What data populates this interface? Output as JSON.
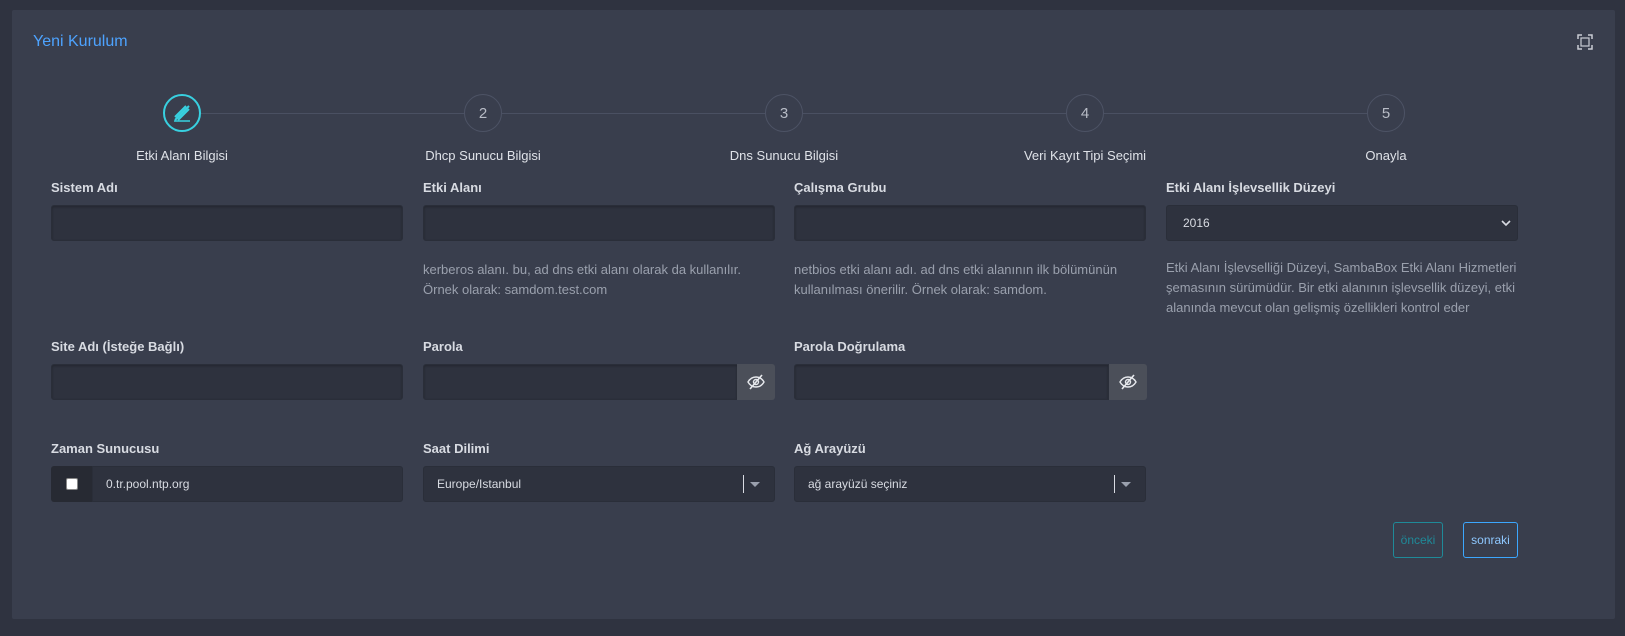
{
  "card": {
    "title": "Yeni Kurulum",
    "fullscreen_icon": "fullscreen-icon"
  },
  "steps": [
    {
      "number": "",
      "label": "Etki Alanı Bilgisi",
      "icon": "edit-icon",
      "active": true
    },
    {
      "number": "2",
      "label": "Dhcp Sunucu Bilgisi"
    },
    {
      "number": "3",
      "label": "Dns Sunucu Bilgisi"
    },
    {
      "number": "4",
      "label": "Veri Kayıt Tipi Seçimi"
    },
    {
      "number": "5",
      "label": "Onayla"
    }
  ],
  "form": {
    "system_name": {
      "label": "Sistem Adı",
      "value": ""
    },
    "domain": {
      "label": "Etki Alanı",
      "value": "",
      "help": "kerberos alanı. bu, ad dns etki alanı olarak da kullanılır. Örnek olarak: samdom.test.com"
    },
    "workgroup": {
      "label": "Çalışma Grubu",
      "value": "",
      "help": "netbios etki alanı adı. ad dns etki alanının ilk bölümünün kullanılması önerilir. Örnek olarak: samdom."
    },
    "functional_level": {
      "label": "Etki Alanı İşlevsellik Düzeyi",
      "value": "2016",
      "help": "Etki Alanı İşlevselliği Düzeyi, SambaBox Etki Alanı Hizmetleri şemasının sürümüdür. Bir etki alanının işlevsellik düzeyi, etki alanında mevcut olan gelişmiş özellikleri kontrol eder"
    },
    "site_name": {
      "label": "Site Adı (İsteğe Bağlı)",
      "value": ""
    },
    "password": {
      "label": "Parola",
      "value": ""
    },
    "password_confirm": {
      "label": "Parola Doğrulama",
      "value": ""
    },
    "time_server": {
      "label": "Zaman Sunucusu",
      "value": "0.tr.pool.ntp.org",
      "checked": false
    },
    "timezone": {
      "label": "Saat Dilimi",
      "value": "Europe/Istanbul"
    },
    "network_interface": {
      "label": "Ağ Arayüzü",
      "value": "ağ arayüzü seçiniz"
    }
  },
  "buttons": {
    "prev": "önceki",
    "next": "sonraki"
  },
  "colors": {
    "accent": "#38d0e0",
    "title": "#4da3ff",
    "card": "#393e4d",
    "background": "#2f3340"
  }
}
